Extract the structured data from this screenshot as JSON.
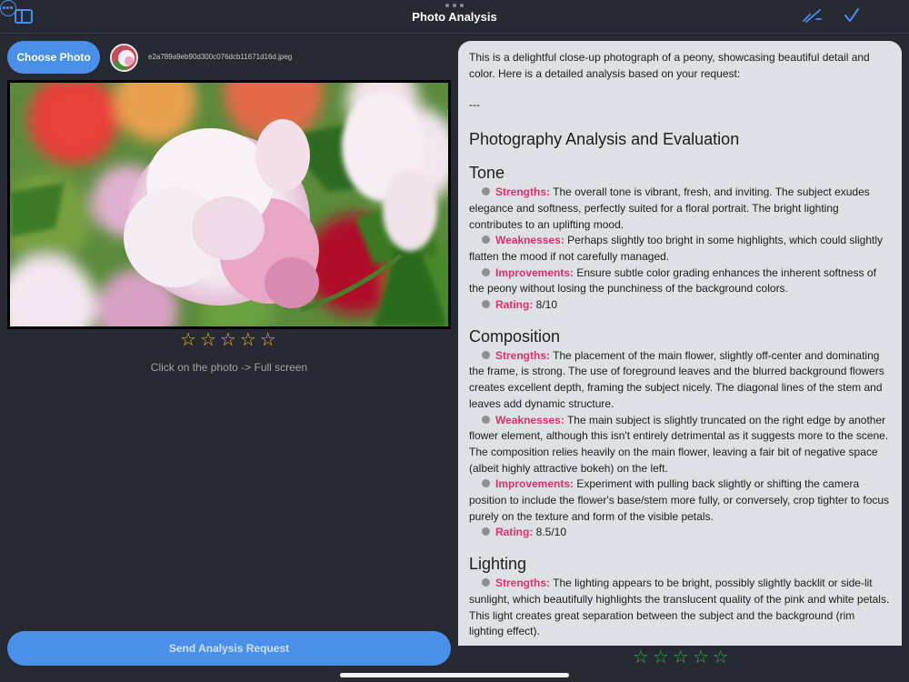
{
  "header": {
    "title": "Photo Analysis"
  },
  "left": {
    "choose_label": "Choose Photo",
    "filename": "e2a789a9eb90d300c076dcb11671d16d.jpeg",
    "photo_rating_stars": 0,
    "hint": "Click on the photo -> Full screen",
    "send_label": "Send Analysis Request"
  },
  "analysis": {
    "intro": "This is a delightful close-up photograph of a peony, showcasing beautiful detail and color. Here is a detailed analysis based on your request:",
    "divider": "---",
    "heading": "Photography Analysis and Evaluation",
    "sections": [
      {
        "title": "Tone",
        "items": [
          {
            "label": "Strengths:",
            "text": " The overall tone is vibrant, fresh, and inviting. The subject exudes elegance and softness, perfectly suited for a floral portrait. The bright lighting contributes to an uplifting mood."
          },
          {
            "label": "Weaknesses:",
            "text": " Perhaps slightly too bright in some highlights, which could slightly flatten the mood if not carefully managed."
          },
          {
            "label": "Improvements:",
            "text": " Ensure subtle color grading enhances the inherent softness of the peony without losing the punchiness of the background colors."
          },
          {
            "label": "Rating:",
            "text": " 8/10"
          }
        ]
      },
      {
        "title": "Composition",
        "items": [
          {
            "label": "Strengths:",
            "text": " The placement of the main flower, slightly off-center and dominating the frame, is strong. The use of foreground leaves and the blurred background flowers creates excellent depth, framing the subject nicely. The diagonal lines of the stem and leaves add dynamic structure."
          },
          {
            "label": "Weaknesses:",
            "text": " The main subject is slightly truncated on the right edge by another flower element, although this isn't entirely detrimental as it suggests more to the scene. The composition relies heavily on the main flower, leaving a fair bit of negative space (albeit highly attractive bokeh) on the left."
          },
          {
            "label": "Improvements:",
            "text": " Experiment with pulling back slightly or shifting the camera position to include the flower's base/stem more fully, or conversely, crop tighter to focus purely on the texture and form of the visible petals."
          },
          {
            "label": "Rating:",
            "text": " 8.5/10"
          }
        ]
      },
      {
        "title": "Lighting",
        "items": [
          {
            "label": "Strengths:",
            "text": " The lighting appears to be bright, possibly slightly backlit or side-lit sunlight, which beautifully highlights the translucent quality of the pink and white petals. This light creates great separation between the subject and the background (rim lighting effect)."
          }
        ]
      }
    ],
    "rating_stars": 0
  },
  "colors": {
    "accent": "#4a8fe8",
    "label_pink": "#e0306a",
    "star_yellow": "#f0c020",
    "star_green": "#2db84a"
  }
}
